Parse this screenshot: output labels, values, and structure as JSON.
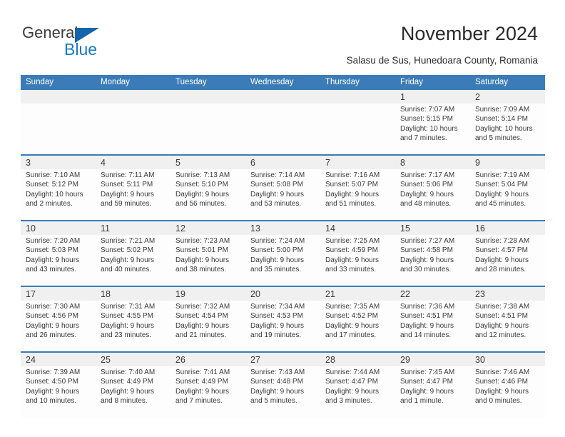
{
  "brand": {
    "name_top": "General",
    "name_bottom": "Blue",
    "accent_color": "#1679c8",
    "triangle_color": "#1464aa"
  },
  "header": {
    "month_title": "November 2024",
    "location": "Salasu de Sus, Hunedoara County, Romania"
  },
  "calendar": {
    "header_bg": "#3b7cb8",
    "daynum_bg": "#f0f0f0",
    "weekdays": [
      "Sunday",
      "Monday",
      "Tuesday",
      "Wednesday",
      "Thursday",
      "Friday",
      "Saturday"
    ],
    "weeks": [
      [
        {
          "day": "",
          "sunrise": "",
          "sunset": "",
          "daylight1": "",
          "daylight2": ""
        },
        {
          "day": "",
          "sunrise": "",
          "sunset": "",
          "daylight1": "",
          "daylight2": ""
        },
        {
          "day": "",
          "sunrise": "",
          "sunset": "",
          "daylight1": "",
          "daylight2": ""
        },
        {
          "day": "",
          "sunrise": "",
          "sunset": "",
          "daylight1": "",
          "daylight2": ""
        },
        {
          "day": "",
          "sunrise": "",
          "sunset": "",
          "daylight1": "",
          "daylight2": ""
        },
        {
          "day": "1",
          "sunrise": "Sunrise: 7:07 AM",
          "sunset": "Sunset: 5:15 PM",
          "daylight1": "Daylight: 10 hours",
          "daylight2": "and 7 minutes."
        },
        {
          "day": "2",
          "sunrise": "Sunrise: 7:09 AM",
          "sunset": "Sunset: 5:14 PM",
          "daylight1": "Daylight: 10 hours",
          "daylight2": "and 5 minutes."
        }
      ],
      [
        {
          "day": "3",
          "sunrise": "Sunrise: 7:10 AM",
          "sunset": "Sunset: 5:12 PM",
          "daylight1": "Daylight: 10 hours",
          "daylight2": "and 2 minutes."
        },
        {
          "day": "4",
          "sunrise": "Sunrise: 7:11 AM",
          "sunset": "Sunset: 5:11 PM",
          "daylight1": "Daylight: 9 hours",
          "daylight2": "and 59 minutes."
        },
        {
          "day": "5",
          "sunrise": "Sunrise: 7:13 AM",
          "sunset": "Sunset: 5:10 PM",
          "daylight1": "Daylight: 9 hours",
          "daylight2": "and 56 minutes."
        },
        {
          "day": "6",
          "sunrise": "Sunrise: 7:14 AM",
          "sunset": "Sunset: 5:08 PM",
          "daylight1": "Daylight: 9 hours",
          "daylight2": "and 53 minutes."
        },
        {
          "day": "7",
          "sunrise": "Sunrise: 7:16 AM",
          "sunset": "Sunset: 5:07 PM",
          "daylight1": "Daylight: 9 hours",
          "daylight2": "and 51 minutes."
        },
        {
          "day": "8",
          "sunrise": "Sunrise: 7:17 AM",
          "sunset": "Sunset: 5:06 PM",
          "daylight1": "Daylight: 9 hours",
          "daylight2": "and 48 minutes."
        },
        {
          "day": "9",
          "sunrise": "Sunrise: 7:19 AM",
          "sunset": "Sunset: 5:04 PM",
          "daylight1": "Daylight: 9 hours",
          "daylight2": "and 45 minutes."
        }
      ],
      [
        {
          "day": "10",
          "sunrise": "Sunrise: 7:20 AM",
          "sunset": "Sunset: 5:03 PM",
          "daylight1": "Daylight: 9 hours",
          "daylight2": "and 43 minutes."
        },
        {
          "day": "11",
          "sunrise": "Sunrise: 7:21 AM",
          "sunset": "Sunset: 5:02 PM",
          "daylight1": "Daylight: 9 hours",
          "daylight2": "and 40 minutes."
        },
        {
          "day": "12",
          "sunrise": "Sunrise: 7:23 AM",
          "sunset": "Sunset: 5:01 PM",
          "daylight1": "Daylight: 9 hours",
          "daylight2": "and 38 minutes."
        },
        {
          "day": "13",
          "sunrise": "Sunrise: 7:24 AM",
          "sunset": "Sunset: 5:00 PM",
          "daylight1": "Daylight: 9 hours",
          "daylight2": "and 35 minutes."
        },
        {
          "day": "14",
          "sunrise": "Sunrise: 7:25 AM",
          "sunset": "Sunset: 4:59 PM",
          "daylight1": "Daylight: 9 hours",
          "daylight2": "and 33 minutes."
        },
        {
          "day": "15",
          "sunrise": "Sunrise: 7:27 AM",
          "sunset": "Sunset: 4:58 PM",
          "daylight1": "Daylight: 9 hours",
          "daylight2": "and 30 minutes."
        },
        {
          "day": "16",
          "sunrise": "Sunrise: 7:28 AM",
          "sunset": "Sunset: 4:57 PM",
          "daylight1": "Daylight: 9 hours",
          "daylight2": "and 28 minutes."
        }
      ],
      [
        {
          "day": "17",
          "sunrise": "Sunrise: 7:30 AM",
          "sunset": "Sunset: 4:56 PM",
          "daylight1": "Daylight: 9 hours",
          "daylight2": "and 26 minutes."
        },
        {
          "day": "18",
          "sunrise": "Sunrise: 7:31 AM",
          "sunset": "Sunset: 4:55 PM",
          "daylight1": "Daylight: 9 hours",
          "daylight2": "and 23 minutes."
        },
        {
          "day": "19",
          "sunrise": "Sunrise: 7:32 AM",
          "sunset": "Sunset: 4:54 PM",
          "daylight1": "Daylight: 9 hours",
          "daylight2": "and 21 minutes."
        },
        {
          "day": "20",
          "sunrise": "Sunrise: 7:34 AM",
          "sunset": "Sunset: 4:53 PM",
          "daylight1": "Daylight: 9 hours",
          "daylight2": "and 19 minutes."
        },
        {
          "day": "21",
          "sunrise": "Sunrise: 7:35 AM",
          "sunset": "Sunset: 4:52 PM",
          "daylight1": "Daylight: 9 hours",
          "daylight2": "and 17 minutes."
        },
        {
          "day": "22",
          "sunrise": "Sunrise: 7:36 AM",
          "sunset": "Sunset: 4:51 PM",
          "daylight1": "Daylight: 9 hours",
          "daylight2": "and 14 minutes."
        },
        {
          "day": "23",
          "sunrise": "Sunrise: 7:38 AM",
          "sunset": "Sunset: 4:51 PM",
          "daylight1": "Daylight: 9 hours",
          "daylight2": "and 12 minutes."
        }
      ],
      [
        {
          "day": "24",
          "sunrise": "Sunrise: 7:39 AM",
          "sunset": "Sunset: 4:50 PM",
          "daylight1": "Daylight: 9 hours",
          "daylight2": "and 10 minutes."
        },
        {
          "day": "25",
          "sunrise": "Sunrise: 7:40 AM",
          "sunset": "Sunset: 4:49 PM",
          "daylight1": "Daylight: 9 hours",
          "daylight2": "and 8 minutes."
        },
        {
          "day": "26",
          "sunrise": "Sunrise: 7:41 AM",
          "sunset": "Sunset: 4:49 PM",
          "daylight1": "Daylight: 9 hours",
          "daylight2": "and 7 minutes."
        },
        {
          "day": "27",
          "sunrise": "Sunrise: 7:43 AM",
          "sunset": "Sunset: 4:48 PM",
          "daylight1": "Daylight: 9 hours",
          "daylight2": "and 5 minutes."
        },
        {
          "day": "28",
          "sunrise": "Sunrise: 7:44 AM",
          "sunset": "Sunset: 4:47 PM",
          "daylight1": "Daylight: 9 hours",
          "daylight2": "and 3 minutes."
        },
        {
          "day": "29",
          "sunrise": "Sunrise: 7:45 AM",
          "sunset": "Sunset: 4:47 PM",
          "daylight1": "Daylight: 9 hours",
          "daylight2": "and 1 minute."
        },
        {
          "day": "30",
          "sunrise": "Sunrise: 7:46 AM",
          "sunset": "Sunset: 4:46 PM",
          "daylight1": "Daylight: 9 hours",
          "daylight2": "and 0 minutes."
        }
      ]
    ]
  }
}
